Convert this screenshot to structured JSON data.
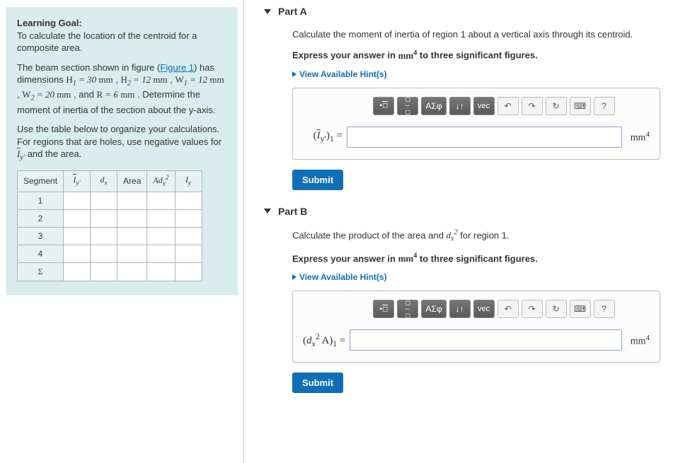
{
  "left": {
    "learning_goal_label": "Learning Goal:",
    "learning_goal_text": "To calculate the location of the centroid for a composite area.",
    "figure_intro_1": "The beam section shown in figure (",
    "figure_link": "Figure 1",
    "figure_intro_2": ") has dimensions ",
    "dims": {
      "H1": "H₁ = 30 mm",
      "H2": "H₂ = 12 mm",
      "W1": "W₁ = 12 mm",
      "W2": "W₂ = 20 mm",
      "R": "R = 6 mm"
    },
    "dim_tail": ". Determine the moment of inertia of the section about the y-axis.",
    "instruct": "Use the table below to organize your calculations. For regions that are holes, use negative values for ",
    "instruct_tail": " and the area.",
    "table": {
      "headers": [
        "Segment",
        "Ī_y′",
        "d_x",
        "Area",
        "Ad_x²",
        "I_y"
      ],
      "rows": [
        "1",
        "2",
        "3",
        "4",
        "Σ"
      ]
    }
  },
  "partA": {
    "title": "Part A",
    "prompt": "Calculate the moment of inertia of region 1 about a vertical axis through its centroid.",
    "express": "Express your answer in mm⁴ to three significant figures.",
    "hints": "View Available Hint(s)",
    "lhs_html": "(Īy′)₁ =",
    "unit": "mm⁴",
    "submit": "Submit"
  },
  "partB": {
    "title": "Part B",
    "prompt_pre": "Calculate the product of the area and ",
    "prompt_mid": "d_x²",
    "prompt_post": " for region 1.",
    "express": "Express your answer in mm⁴ to three significant figures.",
    "hints": "View Available Hint(s)",
    "lhs_html": "(d_x² A)₁ =",
    "unit": "mm⁴",
    "submit": "Submit"
  },
  "toolbar": {
    "template": "template",
    "frac": "frac",
    "greek": "ΑΣφ",
    "subsup": "↓↑",
    "vec": "vec",
    "undo": "↶",
    "redo": "↷",
    "reset": "↻",
    "keyboard": "⌨",
    "help": "?"
  }
}
